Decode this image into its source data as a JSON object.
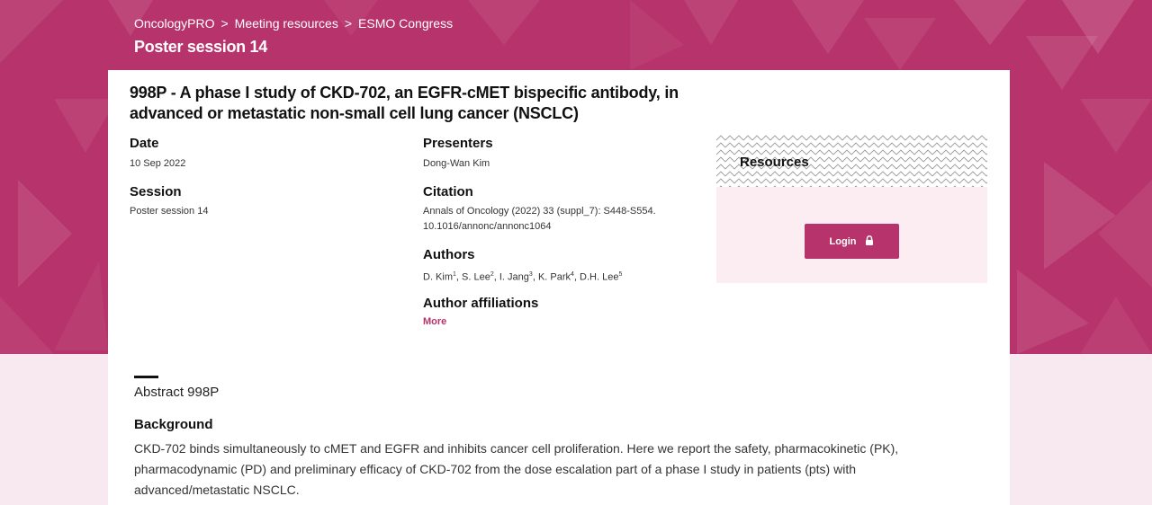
{
  "breadcrumb": [
    "OncologyPRO",
    "Meeting resources",
    "ESMO Congress"
  ],
  "breadcrumb_separator": ">",
  "session_heading": "Poster session 14",
  "title": "998P - A phase I study of CKD-702, an EGFR-cMET bispecific antibody, in advanced or metastatic non-small cell lung cancer (NSCLC)",
  "date": {
    "label": "Date",
    "value": "10 Sep 2022"
  },
  "session": {
    "label": "Session",
    "value": "Poster session 14"
  },
  "presenters": {
    "label": "Presenters",
    "value": "Dong-Wan Kim"
  },
  "citation": {
    "label": "Citation",
    "line1": "Annals of Oncology (2022) 33 (suppl_7): S448-S554.",
    "line2": "10.1016/annonc/annonc1064"
  },
  "authors": {
    "label": "Authors",
    "list": [
      {
        "name": "D. Kim",
        "sup": "1"
      },
      {
        "name": "S. Lee",
        "sup": "2"
      },
      {
        "name": "I. Jang",
        "sup": "3"
      },
      {
        "name": "K. Park",
        "sup": "4"
      },
      {
        "name": "D.H. Lee",
        "sup": "5"
      }
    ]
  },
  "affiliations": {
    "label": "Author affiliations",
    "more": "More"
  },
  "resources": {
    "title": "Resources",
    "login_label": "Login",
    "login_icon": "lock-icon"
  },
  "abstract": {
    "title": "Abstract 998P",
    "background_heading": "Background",
    "background_text": "CKD-702 binds simultaneously to cMET and EGFR and inhibits cancer cell proliferation. Here we report the safety, pharmacokinetic (PK), pharmacodynamic (PD) and preliminary efficacy of CKD-702 from the dose escalation part of a phase I study in patients (pts) with advanced/metastatic NSCLC."
  },
  "colors": {
    "brand": "#b7336b",
    "resources_bg": "#fcedf3",
    "page_bg": "#f8e8ef"
  }
}
